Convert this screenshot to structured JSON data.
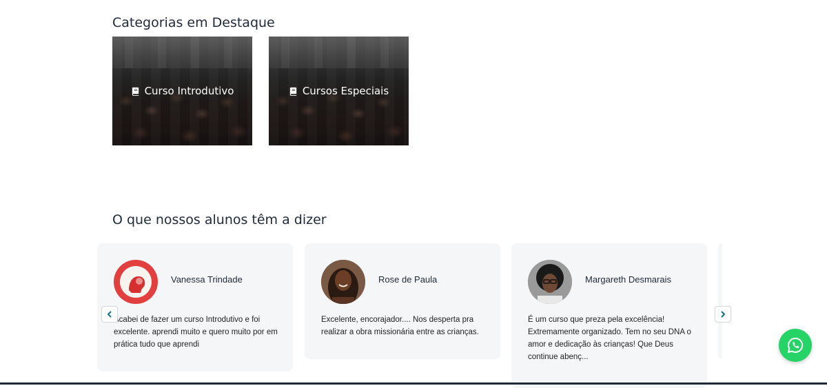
{
  "categories": {
    "title": "Categorias em Destaque",
    "items": [
      {
        "label": "Curso Introdutivo",
        "icon": "book-icon"
      },
      {
        "label": "Cursos Especiais",
        "icon": "book-icon"
      }
    ]
  },
  "testimonials": {
    "title": "O que nossos alunos têm a dizer",
    "items": [
      {
        "name": "Vanessa Trindade",
        "text": "Acabei de fazer um curso Introdutivo e foi excelente. aprendi muito e quero muito por em prática tudo que aprendi"
      },
      {
        "name": "Rose de Paula",
        "text": "Excelente, encorajador.... Nos desperta pra realizar a obra missionária entre as crianças."
      },
      {
        "name": "Margareth Desmarais",
        "text": "É um curso que preza pela excelência! Extremamente organizado. Tem no seu DNA o amor e dedicação às crianças! Que Deus continue abenç..."
      }
    ]
  },
  "colors": {
    "accent": "#0e7490",
    "whatsapp": "#25d366",
    "card_background": "#f5f6f8"
  }
}
